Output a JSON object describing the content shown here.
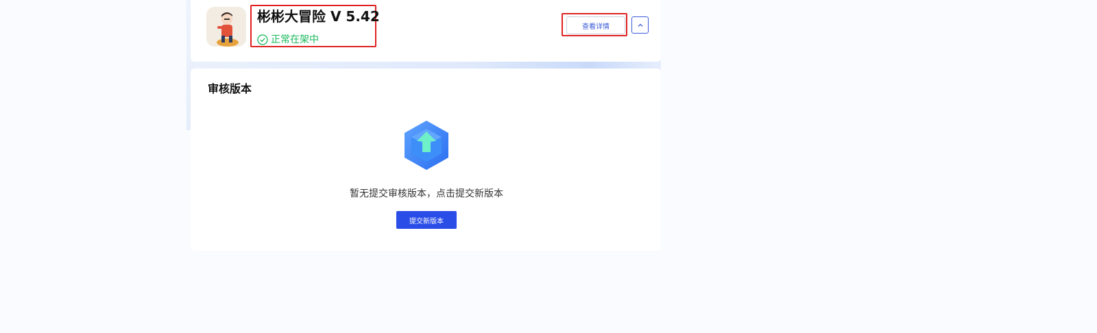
{
  "app": {
    "title": "彬彬大冒险 V 5.42",
    "status": "正常在架中",
    "detail_button": "查看详情"
  },
  "review_section": {
    "title": "审核版本",
    "empty_message": "暂无提交审核版本，点击提交新版本",
    "submit_button": "提交新版本"
  },
  "icons": {
    "status": "check-circle-icon",
    "collapse": "chevron-up-icon",
    "empty": "upload-cube-icon"
  },
  "colors": {
    "accent": "#2a4de8",
    "status_green": "#17b95a",
    "highlight_red": "#e02020"
  }
}
